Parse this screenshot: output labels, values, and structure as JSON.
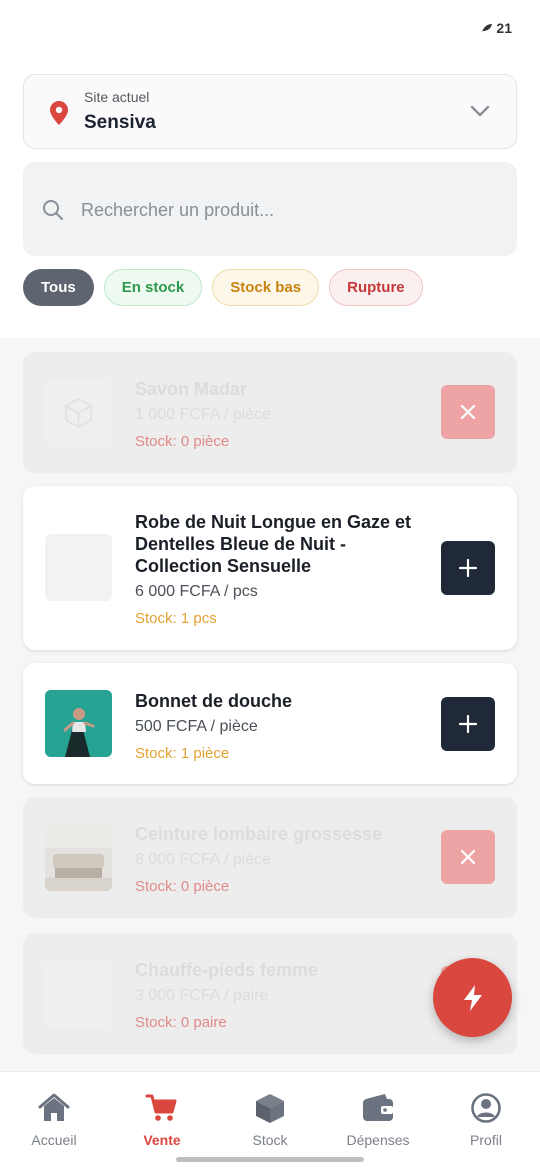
{
  "status_bar": {
    "badge": "21"
  },
  "site_selector": {
    "label": "Site actuel",
    "value": "Sensiva"
  },
  "search": {
    "placeholder": "Rechercher un produit..."
  },
  "filters": [
    {
      "label": "Tous",
      "state": "selected"
    },
    {
      "label": "En stock"
    },
    {
      "label": "Stock bas"
    },
    {
      "label": "Rupture"
    }
  ],
  "products": [
    {
      "name": "Savon Madar",
      "price": "1 000 FCFA / pièce",
      "stock": "Stock: 0 pièce",
      "available": false,
      "image": "box-placeholder-icon"
    },
    {
      "name": "Robe de Nuit Longue en Gaze et Dentelles Bleue de Nuit - Collection Sensuelle",
      "price": "6 000 FCFA / pcs",
      "stock": "Stock: 1 pcs",
      "available": true,
      "image": "blank"
    },
    {
      "name": "Bonnet de douche",
      "price": "500 FCFA / pièce",
      "stock": "Stock: 1 pièce",
      "available": true,
      "image": "photo-teal"
    },
    {
      "name": "Ceinture lombaire grossesse",
      "price": "8 000 FCFA / pièce",
      "stock": "Stock: 0 pièce",
      "available": false,
      "image": "photo-room"
    },
    {
      "name": "Chauffe-pieds femme",
      "price": "3 000 FCFA / paire",
      "stock": "Stock: 0 paire",
      "available": false,
      "image": "blank"
    }
  ],
  "fab": {
    "icon": "lightning-icon"
  },
  "bottom_nav": [
    {
      "label": "Accueil",
      "icon": "home-icon"
    },
    {
      "label": "Vente",
      "icon": "cart-icon",
      "active": true
    },
    {
      "label": "Stock",
      "icon": "cube-icon"
    },
    {
      "label": "Dépenses",
      "icon": "wallet-icon"
    },
    {
      "label": "Profil",
      "icon": "user-circle-icon"
    }
  ],
  "colors": {
    "accent": "#d9473f",
    "dark_button": "#1f2937",
    "in_stock": "#2f9a4d",
    "low_stock": "#c8830e",
    "out_of_stock": "#c73838"
  }
}
